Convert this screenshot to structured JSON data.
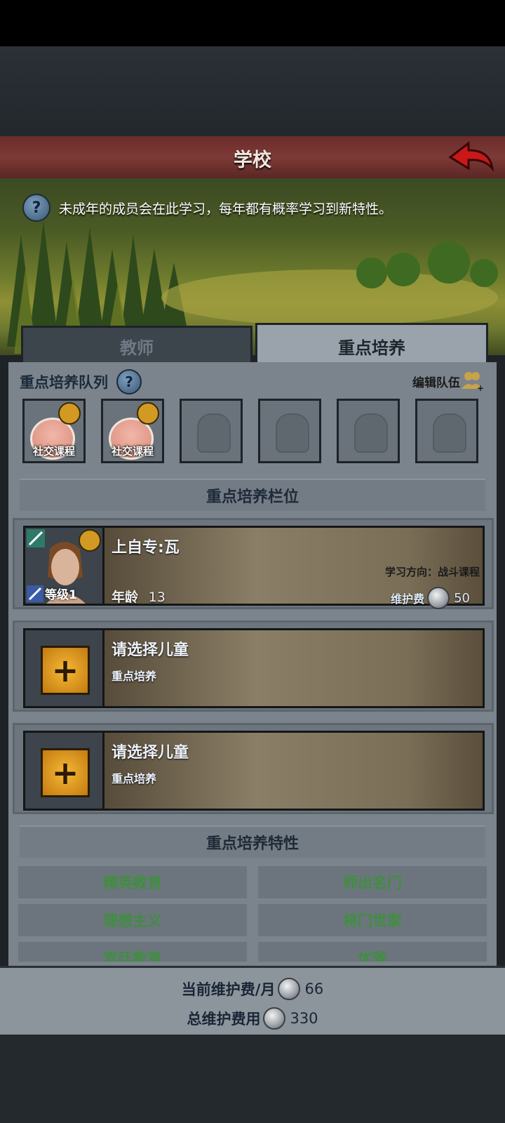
{
  "header": {
    "title": "学校"
  },
  "info": {
    "text": "未成年的成员会在此学习，每年都有概率学习到新特性。"
  },
  "tabs": [
    {
      "label": "教师",
      "active": false
    },
    {
      "label": "重点培养",
      "active": true
    }
  ],
  "queue": {
    "title": "重点培养队列",
    "edit_label": "编辑队伍",
    "slots": [
      {
        "label": "社交课程",
        "filled": true
      },
      {
        "label": "社交课程",
        "filled": true
      },
      {
        "label": "",
        "filled": false
      },
      {
        "label": "",
        "filled": false
      },
      {
        "label": "",
        "filled": false
      },
      {
        "label": "",
        "filled": false
      }
    ]
  },
  "slots_section": {
    "title": "重点培养栏位"
  },
  "member": {
    "name": "上自专:瓦",
    "level_label": "等级1",
    "age_label": "年龄",
    "age": "13",
    "direction": "学习方向：战斗课程",
    "upkeep_label": "维护费",
    "upkeep": "50"
  },
  "empty_slots": [
    {
      "name": "请选择儿童",
      "sub": "重点培养"
    },
    {
      "name": "请选择儿童",
      "sub": "重点培养"
    }
  ],
  "traits_section": {
    "title": "重点培养特性",
    "items": [
      "精英教育",
      "师出名门",
      "理想主义",
      "将门世家",
      "宫廷教育",
      "优雅"
    ]
  },
  "footer": {
    "monthly_label": "当前维护费/月",
    "monthly_value": "66",
    "total_label": "总维护费用",
    "total_value": "330"
  },
  "colors": {
    "header": "#7d3a36",
    "trait_text": "#3f8f3f",
    "plus_button": "#f7b936"
  }
}
